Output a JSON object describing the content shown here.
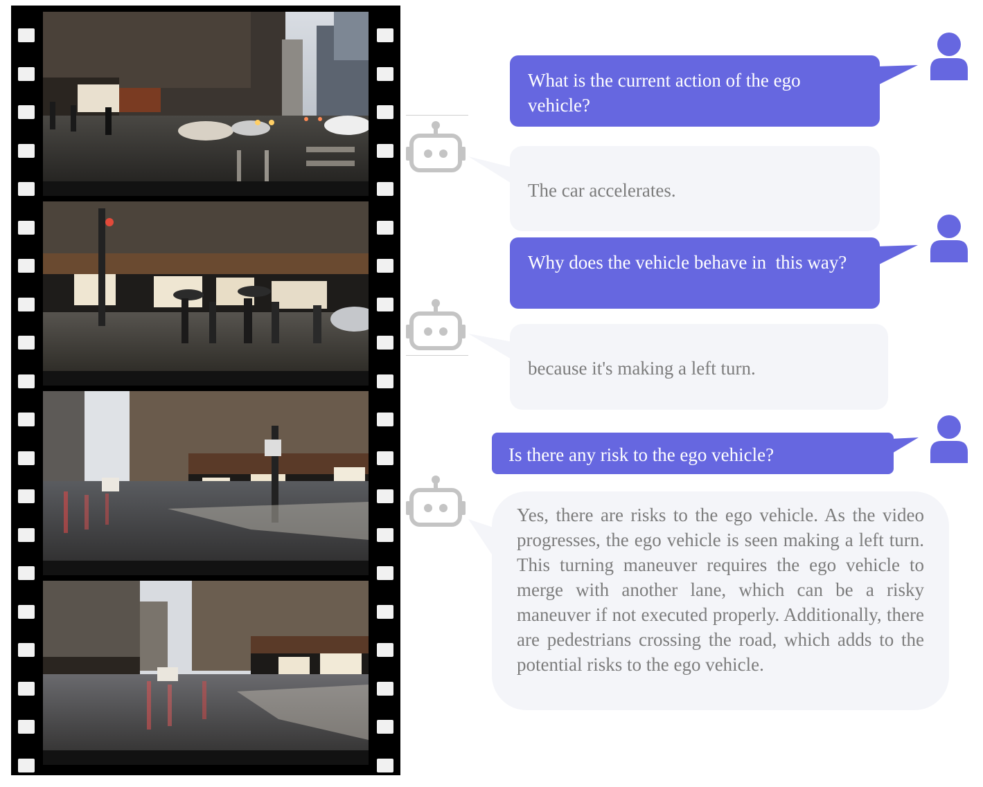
{
  "film_strip": {
    "frames": [
      {
        "name": "frame-1",
        "scene": "wet city street at intersection with traffic and pedestrians"
      },
      {
        "name": "frame-2",
        "scene": "store corner with pedestrians crossing with umbrellas"
      },
      {
        "name": "frame-3",
        "scene": "street during left turn with storefronts"
      },
      {
        "name": "frame-4",
        "scene": "avenue after turn with taillights ahead"
      }
    ]
  },
  "colors": {
    "question_bubble": "#6667e0",
    "answer_bubble": "#f4f5f9",
    "user_icon": "#6667e0",
    "robot_icon": "#c4c4c4",
    "answer_text": "#7c7c7c"
  },
  "conversation": [
    {
      "role": "user",
      "icon": "user-icon",
      "text": "What is the current action of the ego vehicle?"
    },
    {
      "role": "assistant",
      "icon": "robot-icon",
      "text": "The car accelerates."
    },
    {
      "role": "user",
      "icon": "user-icon",
      "text": "Why does the vehicle behave in  this way?"
    },
    {
      "role": "assistant",
      "icon": "robot-icon",
      "text": "because it's making a left turn."
    },
    {
      "role": "user",
      "icon": "user-icon",
      "text": "Is there any risk to the ego vehicle?"
    },
    {
      "role": "assistant",
      "icon": "robot-icon",
      "text": "Yes, there are risks to the ego vehicle. As the video progresses, the ego vehicle is seen making a left turn. This turning maneuver requires the ego vehicle to merge with another lane, which can be a risky maneuver if not executed properly. Additionally, there are pedestrians crossing the road, which adds to the potential risks to the ego vehicle."
    }
  ]
}
